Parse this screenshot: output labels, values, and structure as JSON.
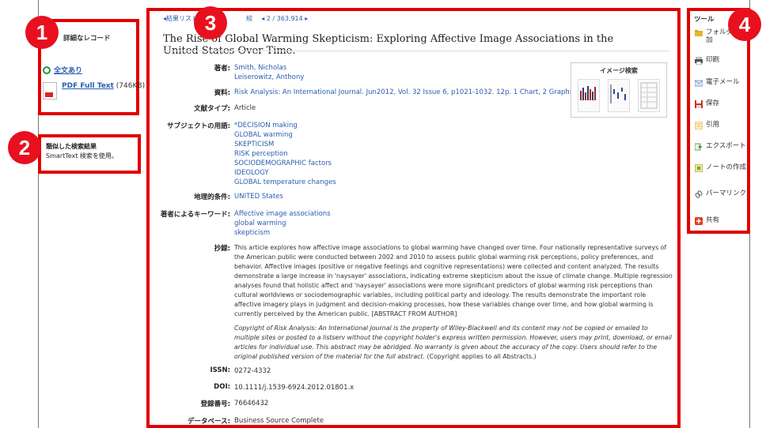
{
  "badges": [
    "1",
    "2",
    "3",
    "4"
  ],
  "left": {
    "detail_title": "詳細なレコード",
    "fulltext_label": "全文あり",
    "pdf_link": "PDF Full Text",
    "pdf_size": "(746KB)",
    "similar_title": "類似した検索結果",
    "similar_sub": "SmartText 検索を使用。"
  },
  "nav": {
    "back": "◂結果リスト",
    "refine": "絞",
    "position": "◂ 2 / 363,914 ▸"
  },
  "article": {
    "title": "The Rise of Global Warming Skepticism: Exploring Affective Image Associations in the United States Over Time.",
    "labels": {
      "authors": "著者:",
      "source": "資料:",
      "doctype": "文献タイプ:",
      "subjects": "サブジェクトの用語:",
      "geo": "地理的条件:",
      "keywords": "著者によるキーワード:",
      "abstract": "抄録:",
      "issn": "ISSN:",
      "doi": "DOI:",
      "accession": "登録番号:",
      "database": "データベース:"
    },
    "authors": [
      "Smith, Nicholas",
      "Leiserowitz, Anthony"
    ],
    "source": "Risk Analysis: An International Journal. Jun2012, Vol. 32 Issue 6, p1021-1032. 12p. 1 Chart, 2 Graphs.",
    "doctype": "Article",
    "subjects": [
      "*DECISION making",
      "GLOBAL warming",
      "SKEPTICISM",
      "RISK perception",
      "SOCIODEMOGRAPHIC factors",
      "IDEOLOGY",
      "GLOBAL temperature changes"
    ],
    "geo": "UNITED States",
    "keywords": [
      "Affective image associations",
      "global warming",
      "skepticism"
    ],
    "abstract": "This article explores how affective image associations to global warming have changed over time. Four nationally representative surveys of the American public were conducted between 2002 and 2010 to assess public global warming risk perceptions, policy preferences, and behavior. Affective images (positive or negative feelings and cognitive representations) were collected and content analyzed. The results demonstrate a large increase in 'naysayer' associations, indicating extreme skepticism about the issue of climate change. Multiple regression analyses found that holistic affect and 'naysayer' associations were more significant predictors of global warming risk perceptions than cultural worldviews or sociodemographic variables, including political party and ideology. The results demonstrate the important role affective imagery plays in judgment and decision-making processes, how these variables change over time, and how global warming is currently perceived by the American public. [ABSTRACT FROM AUTHOR]",
    "copyright": "Copyright of Risk Analysis: An International Journal is the property of Wiley-Blackwell and its content may not be copied or emailed to multiple sites or posted to a listserv without the copyright holder's express written permission. However, users may print, download, or email articles for individual use. This abstract may be abridged. No warranty is given about the accuracy of the copy. Users should refer to the original published version of the material for the full abstract.",
    "copyright_tail": "(Copyright applies to all Abstracts.)",
    "issn": "0272-4332",
    "doi": "10.1111/j.1539-6924.2012.01801.x",
    "accession": "76646432",
    "database": "Business Source Complete"
  },
  "image_search": {
    "title": "イメージ検索"
  },
  "tools": {
    "title": "ツール",
    "items": [
      {
        "label": "フォルダへ追加",
        "icon": "folder-icon",
        "color": "#e8b52a"
      },
      {
        "label": "印刷",
        "icon": "printer-icon",
        "color": "#555555"
      },
      {
        "label": "電子メール",
        "icon": "email-icon",
        "color": "#6a8fb5"
      },
      {
        "label": "保存",
        "icon": "save-icon",
        "color": "#c0392b"
      },
      {
        "label": "引用",
        "icon": "cite-icon",
        "color": "#e0a020"
      },
      {
        "label": "エクスポート",
        "icon": "export-icon",
        "color": "#4a8a3a"
      },
      {
        "label": "ノートの作成",
        "icon": "note-icon",
        "color": "#8a9a2a"
      },
      {
        "label": "パーマリンク",
        "icon": "link-icon",
        "color": "#555555"
      },
      {
        "label": "共有",
        "icon": "share-icon",
        "color": "#e04020"
      }
    ]
  },
  "colors": {
    "annotation_red": "#e00000",
    "link_blue": "#2a5db0"
  }
}
